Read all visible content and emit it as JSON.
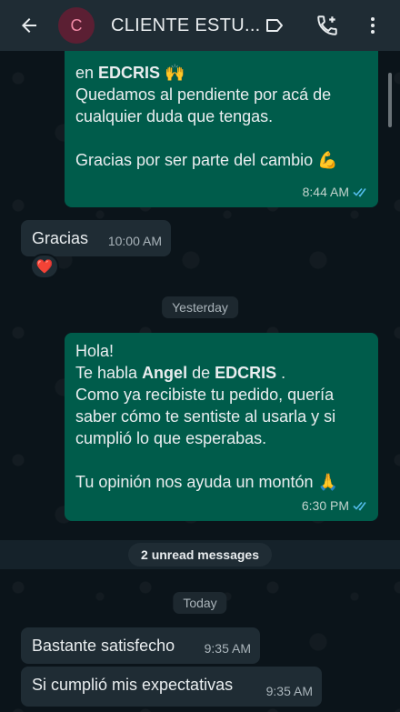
{
  "header": {
    "avatar_letter": "C",
    "title": "CLIENTE ESTU...",
    "back_icon": "arrow-left-icon",
    "label_icon": "label-icon",
    "call_icon": "add-call-icon",
    "menu_icon": "more-vert-icon"
  },
  "messages": {
    "m1": {
      "line_partial_prefix": "en ",
      "line_partial_bold": "EDCRIS",
      "line_partial_emoji": "🙌",
      "body": "Quedamos al pendiente por acá de cualquier duda que tengas.",
      "thanks": "Gracias por ser parte del cambio",
      "thanks_emoji": "💪",
      "time": "8:44 AM"
    },
    "m2": {
      "text": "Gracias",
      "time": "10:00 AM",
      "reaction": "❤️"
    },
    "m3": {
      "hola": "Hola!",
      "habla_prefix": "Te habla ",
      "habla_name": "Angel",
      "habla_mid": " de ",
      "habla_brand": "EDCRIS",
      "habla_end": " .",
      "body": "Como ya recibiste tu pedido, quería saber cómo te sentiste al usarla y si cumplió lo que esperabas.",
      "opinion": "Tu opinión nos ayuda un montón",
      "opinion_emoji": "🙏",
      "time": "6:30 PM"
    },
    "m4": {
      "text": "Bastante satisfecho",
      "time": "9:35 AM"
    },
    "m5": {
      "text": "Si cumplió mis expectativas",
      "time": "9:35 AM"
    }
  },
  "dividers": {
    "yesterday": "Yesterday",
    "unread": "2 unread messages",
    "today": "Today"
  },
  "colors": {
    "header": "#1f2c34",
    "outgoing": "#005c4b",
    "incoming": "#1f2c34",
    "read_ticks": "#53bdeb",
    "background": "#0b141a"
  }
}
